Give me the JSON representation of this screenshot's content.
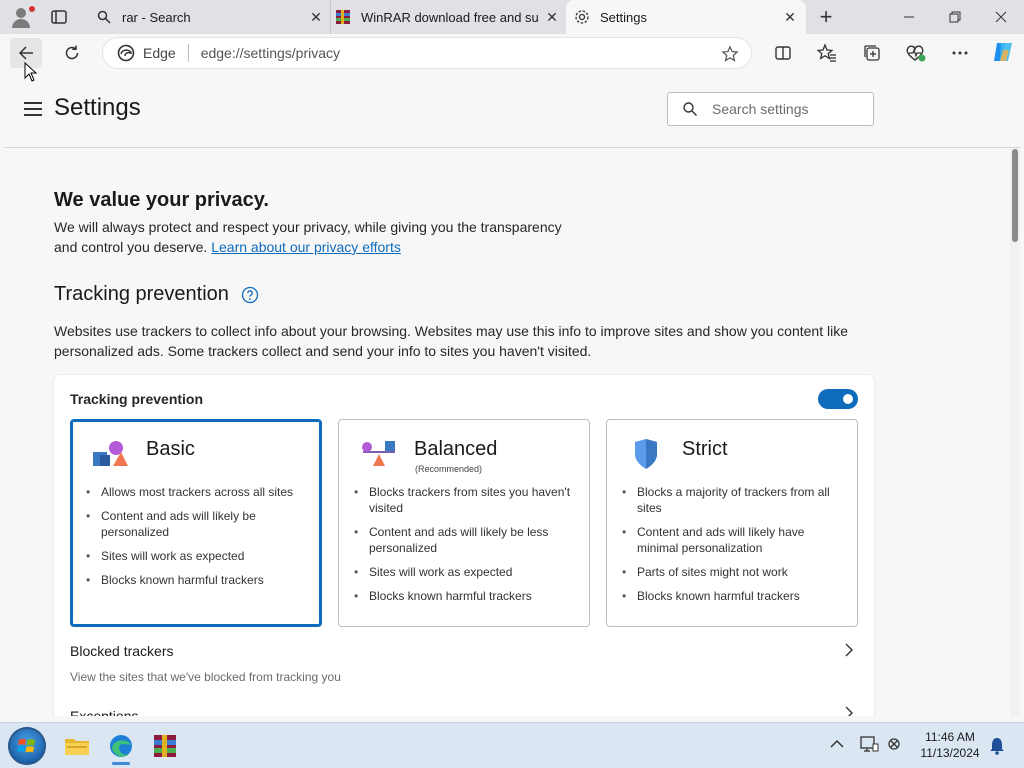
{
  "browser": {
    "tabs": [
      {
        "title": "rar - Search"
      },
      {
        "title": "WinRAR download free and supp"
      },
      {
        "title": "Settings"
      }
    ],
    "address": {
      "identity": "Edge",
      "url": "edge://settings/privacy"
    }
  },
  "settings": {
    "page_title": "Settings",
    "search_placeholder": "Search settings",
    "privacy_heading": "We value your privacy.",
    "privacy_text": "We will always protect and respect your privacy, while giving you the transparency and control you deserve.",
    "privacy_link": "Learn about our privacy efforts",
    "tracking_heading": "Tracking prevention",
    "tracking_desc": "Websites use trackers to collect info about your browsing. Websites may use this info to improve sites and show you content like personalized ads. Some trackers collect and send your info to sites you haven't visited.",
    "card_label": "Tracking prevention",
    "toggle_on": true,
    "selected_level": "Basic",
    "levels": [
      {
        "name": "Basic",
        "subtitle": "",
        "bullets": [
          "Allows most trackers across all sites",
          "Content and ads will likely be personalized",
          "Sites will work as expected",
          "Blocks known harmful trackers"
        ]
      },
      {
        "name": "Balanced",
        "subtitle": "(Recommended)",
        "bullets": [
          "Blocks trackers from sites you haven't visited",
          "Content and ads will likely be less personalized",
          "Sites will work as expected",
          "Blocks known harmful trackers"
        ]
      },
      {
        "name": "Strict",
        "subtitle": "",
        "bullets": [
          "Blocks a majority of trackers from all sites",
          "Content and ads will likely have minimal personalization",
          "Parts of sites might not work",
          "Blocks known harmful trackers"
        ]
      }
    ],
    "blocked_trackers": {
      "title": "Blocked trackers",
      "subtitle": "View the sites that we've blocked from tracking you"
    },
    "exceptions": {
      "title": "Exceptions"
    }
  },
  "taskbar": {
    "time": "11:46 AM",
    "date": "11/13/2024"
  },
  "colors": {
    "accent": "#0f6cbd"
  }
}
